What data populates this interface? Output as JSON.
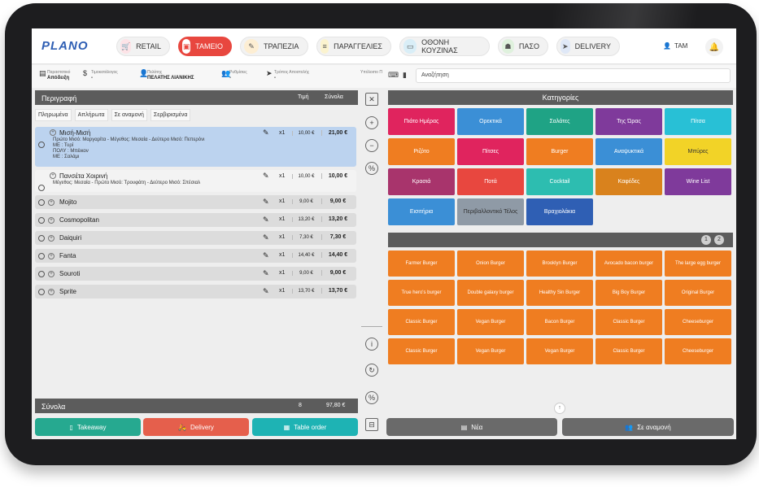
{
  "app": {
    "logo": "PLANO"
  },
  "nav": [
    {
      "label": "RETAIL",
      "icon": "cart-icon",
      "symbol": "🛒",
      "active": false
    },
    {
      "label": "ΤΑΜΕΙΟ",
      "icon": "register-icon",
      "symbol": "▣",
      "active": true
    },
    {
      "label": "ΤΡΑΠΕΖΙΑ",
      "icon": "table-icon",
      "symbol": "✎",
      "active": false
    },
    {
      "label": "ΠΑΡΑΓΓΕΛΙΕΣ",
      "icon": "orders-icon",
      "symbol": "≡",
      "active": false
    },
    {
      "label": "ΟΘΟΝΗ ΚΟΥΖΙΝΑΣ",
      "icon": "screen-icon",
      "symbol": "▭",
      "active": false
    },
    {
      "label": "ΠΑΣΟ",
      "icon": "dish-icon",
      "symbol": "☗",
      "active": false
    },
    {
      "label": "DELIVERY",
      "icon": "delivery-icon",
      "symbol": "➤",
      "active": false
    }
  ],
  "user": {
    "name": "TAM"
  },
  "info": [
    {
      "label": "Παραστατικό",
      "value": "Απόδειξη",
      "icon": "document-icon",
      "symbol": "▤"
    },
    {
      "label": "Τιμοκατάλογος",
      "value": "-",
      "icon": "pricelist-icon",
      "symbol": "$"
    },
    {
      "label": "Πελάτης",
      "value": "ΠΕΛΑΤΗΣ ΛΙΑΝΙΚΗΣ",
      "icon": "customer-icon",
      "symbol": "👤"
    },
    {
      "label": "Ρυθμίσεις",
      "value": "-",
      "icon": "settings-user-icon",
      "symbol": "👥"
    },
    {
      "label": "Τρόπος Αποστολής",
      "value": "-",
      "icon": "send-icon",
      "symbol": "➤"
    },
    {
      "label": "Υπόλοιπο Π",
      "value": "",
      "icon": "",
      "symbol": ""
    }
  ],
  "search": {
    "placeholder": "Αναζήτηση"
  },
  "order": {
    "header": {
      "description": "Περιγραφή",
      "price": "Τιμή",
      "total": "Σύνολα"
    },
    "filters": [
      "Πληρωμένα",
      "Απλήρωτα",
      "Σε αναμονή",
      "Σερβιρισμένα"
    ],
    "items": [
      {
        "name": "Μισή-Μισή",
        "mods": [
          "Πρώτο Μισό: Μαργαρίτα - Μέγεθος: Μεσαία - Δεύτερο Μισό: Πεπερόνι",
          "ΜΕ : Τυρί",
          "ΠΟΛΥ : Μπέικον",
          "ΜΕ : Σαλάμι"
        ],
        "qty": "x1",
        "price": "10,00 €",
        "total": "21,00 €"
      },
      {
        "name": "Πανσέτα Χοιρινή",
        "mods": [
          "Μέγεθος: Μεσαία - Πρώτο Μισό: Τρουφάτη - Δεύτερο Μισό: Σπέσιαλ"
        ],
        "qty": "x1",
        "price": "10,00 €",
        "total": "10,00 €"
      },
      {
        "name": "Mojito",
        "mods": [],
        "qty": "x1",
        "price": "9,00 €",
        "total": "9,00 €"
      },
      {
        "name": "Cosmopolitan",
        "mods": [],
        "qty": "x1",
        "price": "13,20 €",
        "total": "13,20 €"
      },
      {
        "name": "Daiquiri",
        "mods": [],
        "qty": "x1",
        "price": "7,30 €",
        "total": "7,30 €"
      },
      {
        "name": "Fanta",
        "mods": [],
        "qty": "x1",
        "price": "14,40 €",
        "total": "14,40 €"
      },
      {
        "name": "Souroti",
        "mods": [],
        "qty": "x1",
        "price": "9,00 €",
        "total": "9,00 €"
      },
      {
        "name": "Sprite",
        "mods": [],
        "qty": "x1",
        "price": "13,70 €",
        "total": "13,70 €"
      }
    ],
    "totals": {
      "label": "Σύνολα",
      "count": "8",
      "amount": "97,80 €"
    }
  },
  "bottom_left": [
    {
      "label": "Takeaway",
      "color": "#26a990",
      "symbol": "▯"
    },
    {
      "label": "Delivery",
      "color": "#e55f4c",
      "symbol": "🛵"
    },
    {
      "label": "Table order",
      "color": "#1eb3b4",
      "symbol": "▦"
    }
  ],
  "tools": [
    {
      "name": "delete-icon",
      "symbol": "✕",
      "square": true
    },
    {
      "name": "plus-icon",
      "symbol": "+",
      "square": false
    },
    {
      "name": "minus-icon",
      "symbol": "−",
      "square": false
    },
    {
      "name": "percent-icon",
      "symbol": "%",
      "square": false
    },
    {
      "name": "info-icon",
      "symbol": "i",
      "square": false
    },
    {
      "name": "refresh-icon",
      "symbol": "↻",
      "square": false
    },
    {
      "name": "discount-icon",
      "symbol": "%",
      "square": false
    },
    {
      "name": "split-icon",
      "symbol": "⊟",
      "square": true
    }
  ],
  "categories": {
    "title": "Κατηγορίες",
    "items": [
      {
        "label": "Πιάτο Ημέρας",
        "color": "#e0245e"
      },
      {
        "label": "Ορεκτικά",
        "color": "#3b8fd6"
      },
      {
        "label": "Σαλάτες",
        "color": "#1fa385"
      },
      {
        "label": "Της Ώρας",
        "color": "#7f3a9b"
      },
      {
        "label": "Πίτσα",
        "color": "#28c0d6"
      },
      {
        "label": "Ριζότο",
        "color": "#ef7d21"
      },
      {
        "label": "Πίτσες",
        "color": "#e0245e"
      },
      {
        "label": "Burger",
        "color": "#ef7d21"
      },
      {
        "label": "Αναψυκτικά",
        "color": "#3b8fd6"
      },
      {
        "label": "Μπύρες",
        "color": "#f2d327",
        "dark": true
      },
      {
        "label": "Κρασιά",
        "color": "#a8346c"
      },
      {
        "label": "Ποτά",
        "color": "#e8473f"
      },
      {
        "label": "Cocktail",
        "color": "#2dbdb0"
      },
      {
        "label": "Καφέδες",
        "color": "#d9821d"
      },
      {
        "label": "Wine List",
        "color": "#7f3a9b"
      },
      {
        "label": "Εισιτήρια",
        "color": "#3b8fd6"
      },
      {
        "label": "Περιβαλλοντικό Τέλος",
        "color": "#8f9aa6",
        "dark": true
      },
      {
        "label": "Βραχιολάκια",
        "color": "#2f5fb4"
      }
    ]
  },
  "pager": [
    "1",
    "2"
  ],
  "products": [
    "Farmer Burger",
    "Onion Burger",
    "Brooklyn Burger",
    "Avocado bacon burger",
    "The large egg burger",
    "True hero's burger",
    "Double galaxy burger",
    "Healthy Sin Burger",
    "Big Boy Burger",
    "Original Burger",
    "Classic Burger",
    "Vegan Burger",
    "Bacon Burger",
    "Classic Burger",
    "Cheeseburger",
    "Classic Burger",
    "Vegan Burger",
    "Vegan Burger",
    "Classic Burger",
    "Cheeseburger"
  ],
  "actions": [
    {
      "label": "Νέα",
      "symbol": "▤"
    },
    {
      "label": "Σε αναμονή",
      "symbol": "👥"
    }
  ],
  "up_symbol": "↑"
}
